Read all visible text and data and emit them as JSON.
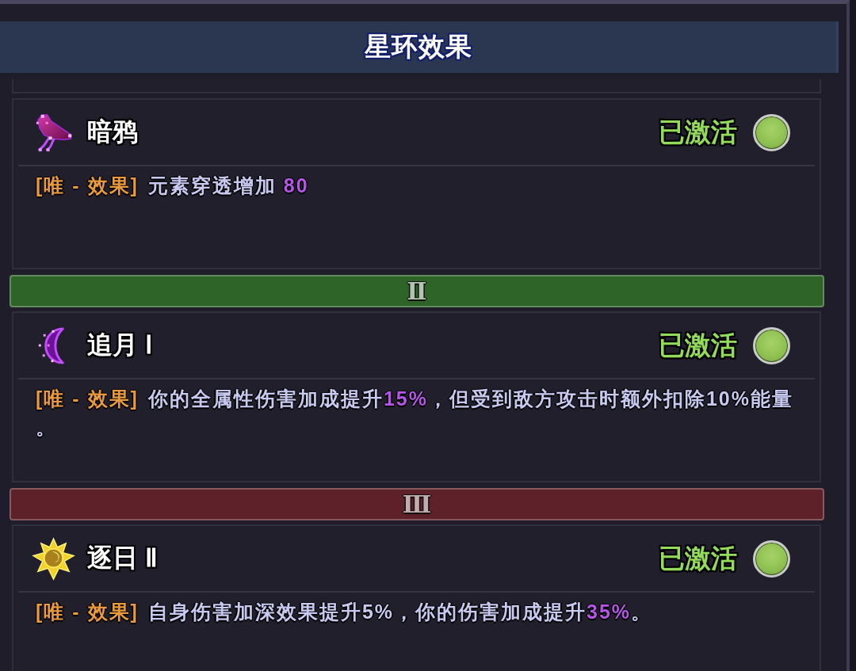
{
  "header": {
    "title": "星环效果"
  },
  "sections": [
    {
      "kind": "effect",
      "name": "暗鸦",
      "status": "已激活",
      "active": true,
      "tag": "[唯 - 效果]",
      "description": [
        {
          "text": "元素穿透增加 ",
          "highlight": false
        },
        {
          "text": "80",
          "highlight": true
        }
      ]
    },
    {
      "kind": "tier",
      "label": "Ⅱ",
      "color": "#2f6429"
    },
    {
      "kind": "effect",
      "name": "追月 Ⅰ",
      "status": "已激活",
      "active": true,
      "tag": "[唯 - 效果]",
      "description": [
        {
          "text": "你的全属性伤害加成提升",
          "highlight": false
        },
        {
          "text": "15%",
          "highlight": true
        },
        {
          "text": "，但受到敌方攻击时额外扣除10%能量。",
          "highlight": false
        }
      ]
    },
    {
      "kind": "tier",
      "label": "Ⅲ",
      "color": "#5e2129"
    },
    {
      "kind": "effect",
      "name": "逐日 Ⅱ",
      "status": "已激活",
      "active": true,
      "tag": "[唯 - 效果]",
      "description": [
        {
          "text": "自身伤害加深效果提升5%，你的伤害加成提升",
          "highlight": false
        },
        {
          "text": "35%",
          "highlight": true
        },
        {
          "text": "。",
          "highlight": false
        }
      ]
    }
  ]
}
